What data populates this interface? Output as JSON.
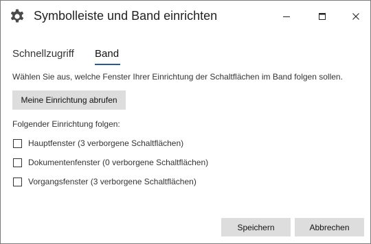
{
  "window": {
    "title": "Symbolleiste und Band einrichten",
    "icon": "gear-icon",
    "controls": [
      "minimize-icon",
      "maximize-icon",
      "close-icon"
    ]
  },
  "tabs": {
    "items": [
      {
        "label": "Schnellzugriff",
        "active": false
      },
      {
        "label": "Band",
        "active": true
      }
    ],
    "accent_color": "#2b5797"
  },
  "main": {
    "description": "Wählen Sie aus, welche Fenster Ihrer Einrichtung der Schaltflächen im Band folgen sollen.",
    "fetch_button_label": "Meine Einrichtung abrufen",
    "follow_label": "Folgender Einrichtung folgen:",
    "checkboxes": [
      {
        "label": "Hauptfenster (3 verborgene Schaltflächen)",
        "checked": false
      },
      {
        "label": "Dokumentenfenster (0 verborgene Schaltflächen)",
        "checked": false
      },
      {
        "label": "Vorgangsfenster (3 verborgene Schaltflächen)",
        "checked": false
      }
    ]
  },
  "footer": {
    "save_label": "Speichern",
    "cancel_label": "Abbrechen"
  }
}
